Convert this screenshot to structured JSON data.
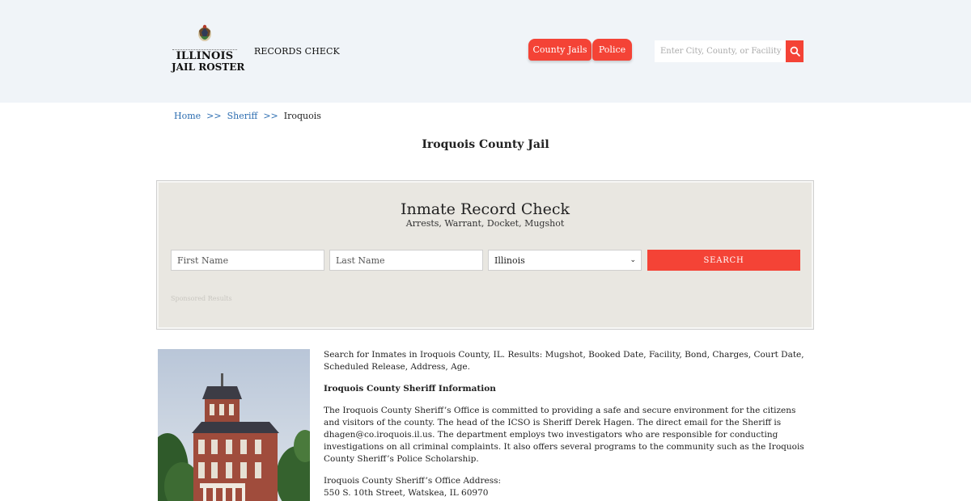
{
  "header": {
    "logo_line1": "ILLINOIS",
    "logo_line2": "JAIL ROSTER",
    "records_check": "RECORDS CHECK",
    "nav_county_jails": "County Jails",
    "nav_police": "Police",
    "search_placeholder": "Enter City, County, or Facility",
    "accent_color": "#f44336"
  },
  "breadcrumb": {
    "home": "Home",
    "sheriff": "Sheriff",
    "current": "Iroquois",
    "separator": ">>"
  },
  "page_title": "Iroquois County Jail",
  "record_check": {
    "title": "Inmate Record Check",
    "subtitle": "Arrests, Warrant, Docket, Mugshot",
    "first_name_placeholder": "First Name",
    "last_name_placeholder": "Last Name",
    "state_selected": "Illinois",
    "search_label": "SEARCH",
    "sponsored": "Sponsored Results"
  },
  "content": {
    "intro": "Search for Inmates in Iroquois County, IL. Results: Mugshot, Booked Date, Facility, Bond, Charges, Court Date, Scheduled Release, Address, Age.",
    "heading": "Iroquois County Sheriff Information",
    "body": "The Iroquois County Sheriff’s Office is committed to providing a safe and secure environment for the citizens and visitors of the county. The head of the ICSO is Sheriff Derek Hagen. The direct email for the Sheriff is dhagen@co.iroquois.il.us. The department employs two investigators who are responsible for conducting investigations on all criminal complaints. It also offers several programs to the community such as the Iroquois County Sheriff’s Police Scholarship.",
    "address_label": "Iroquois County Sheriff’s Office Address:",
    "address": "550 S. 10th Street, Watskea, IL 60970"
  }
}
